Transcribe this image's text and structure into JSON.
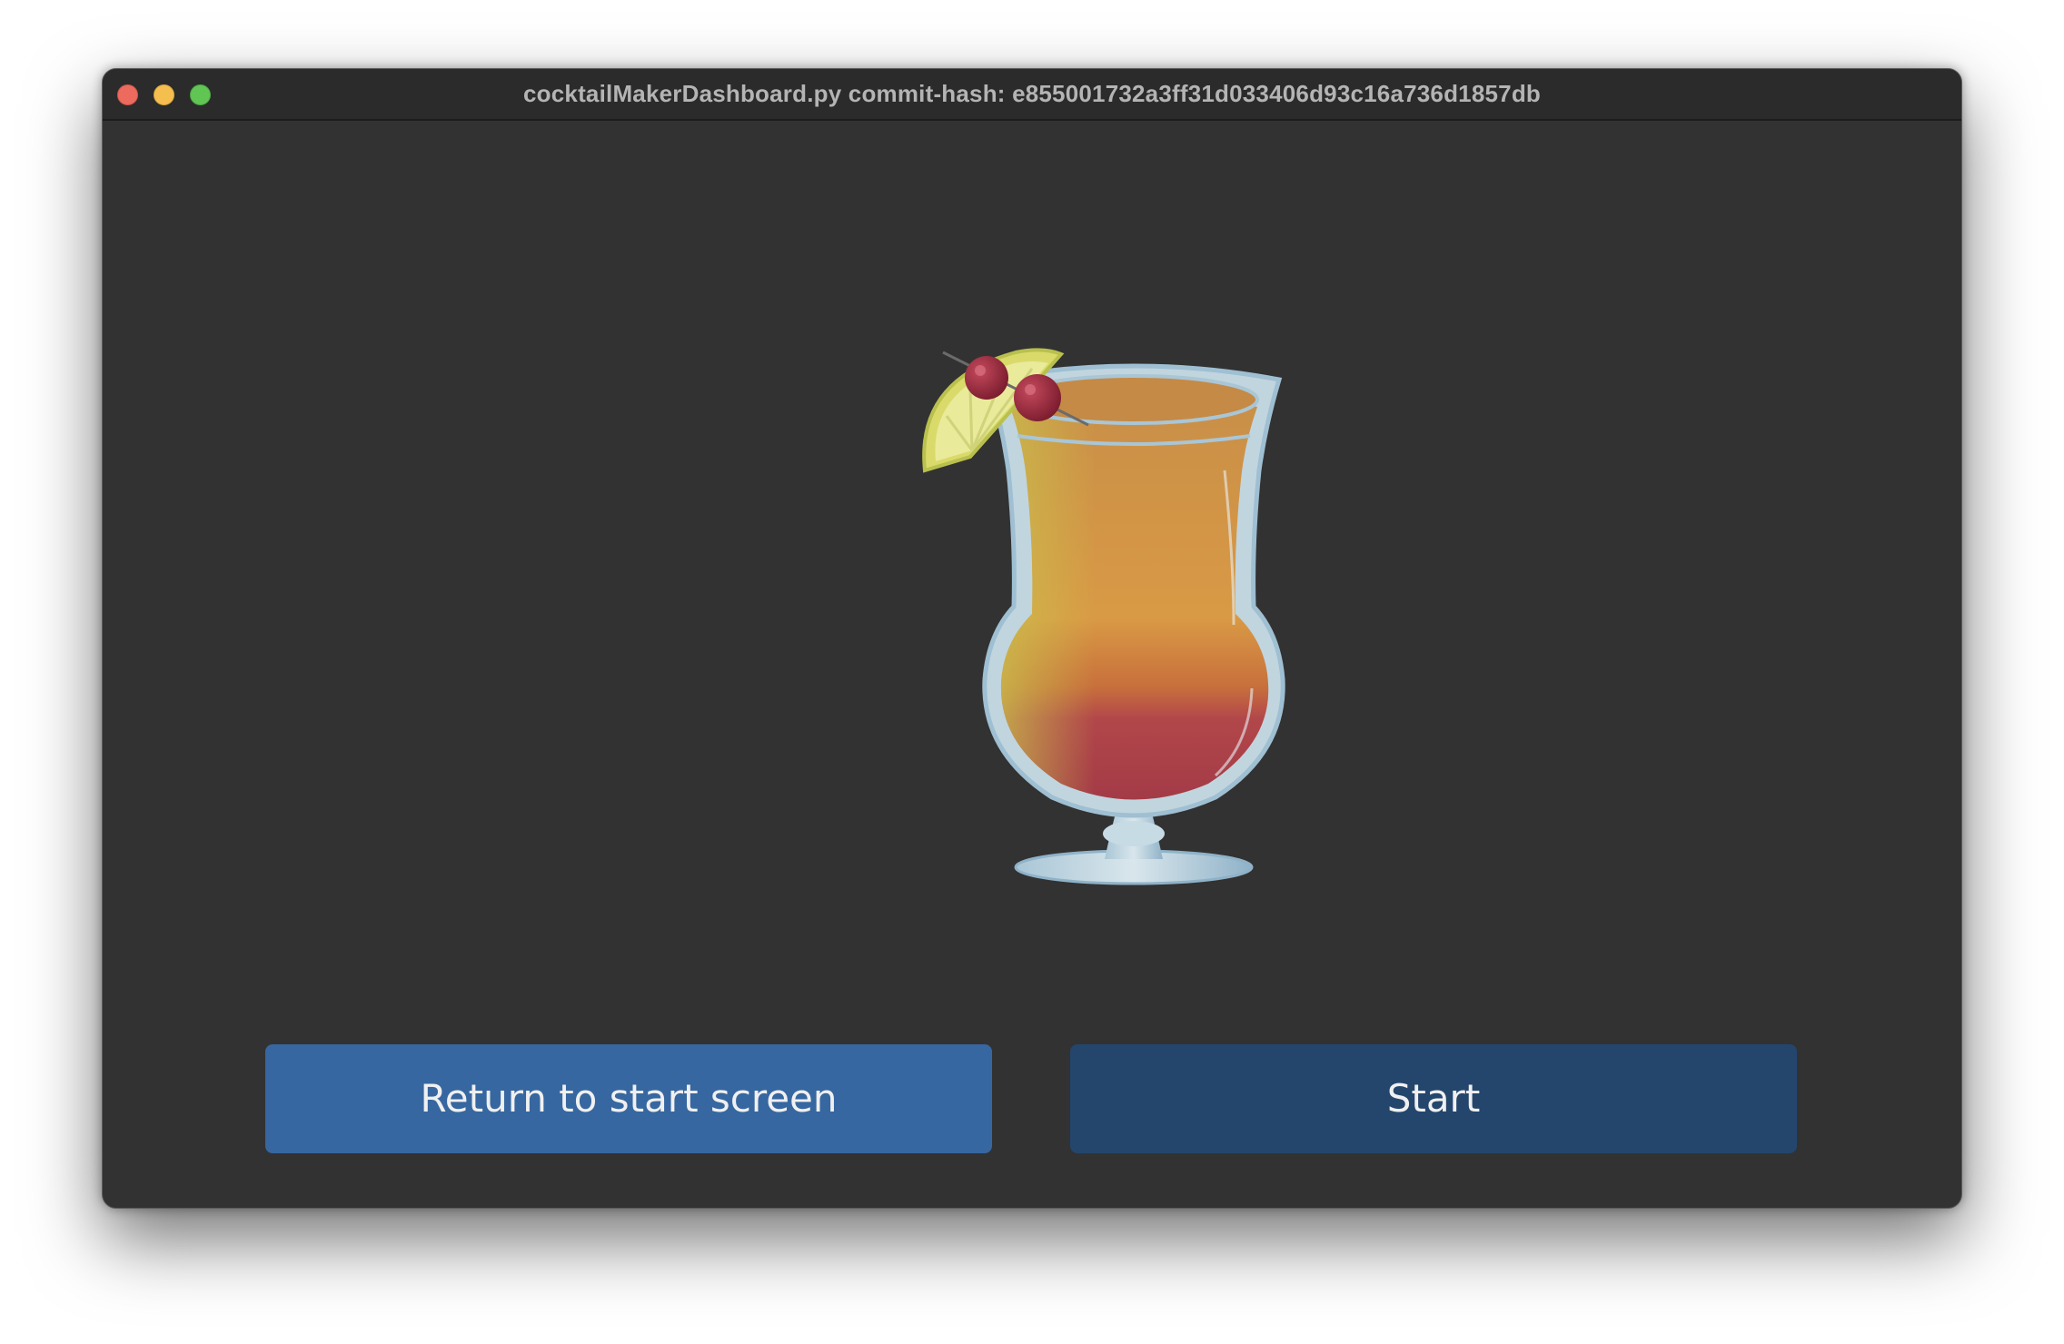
{
  "window": {
    "title": "cocktailMakerDashboard.py commit-hash: e855001732a3ff31d033406d93c16a736d1857db"
  },
  "illustration": {
    "icon": "cocktail-glass-icon"
  },
  "buttons": {
    "return_label": "Return to start screen",
    "start_label": "Start"
  },
  "colors": {
    "window_background": "#323232",
    "titlebar_background": "#2b2b2b",
    "return_button": "#3767a0",
    "start_button": "#24466d",
    "close_light": "#ed6a5e",
    "minimize_light": "#f4bf4f",
    "zoom_light": "#61c554"
  }
}
